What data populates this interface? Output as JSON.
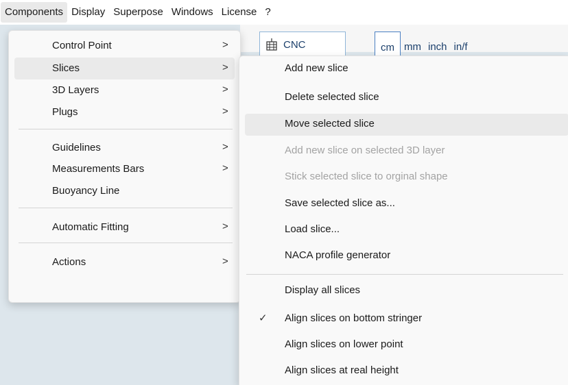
{
  "menubar": {
    "items": [
      "Components",
      "Display",
      "Superpose",
      "Windows",
      "License",
      "?"
    ]
  },
  "toolbar": {
    "cnc_label": "CNC",
    "units": [
      "cm",
      "mm",
      "inch",
      "in/f"
    ]
  },
  "components_menu": {
    "items": [
      {
        "label": "Control Point",
        "submenu": true
      },
      {
        "label": "Slices",
        "submenu": true
      },
      {
        "label": "3D Layers",
        "submenu": true
      },
      {
        "label": "Plugs",
        "submenu": true
      },
      {
        "label": "Guidelines",
        "submenu": true
      },
      {
        "label": "Measurements Bars",
        "submenu": true
      },
      {
        "label": "Buoyancy Line",
        "submenu": false
      },
      {
        "label": "Automatic Fitting",
        "submenu": true
      },
      {
        "label": "Actions",
        "submenu": true
      }
    ],
    "arrow": ">"
  },
  "slices_menu": {
    "items": [
      {
        "label": "Add new slice",
        "enabled": true
      },
      {
        "label": "Delete selected slice",
        "enabled": true
      },
      {
        "label": "Move selected slice",
        "enabled": true
      },
      {
        "label": "Add new slice on selected 3D layer",
        "enabled": false
      },
      {
        "label": "Stick selected slice to orginal shape",
        "enabled": false
      },
      {
        "label": "Save selected slice as...",
        "enabled": true
      },
      {
        "label": "Load slice...",
        "enabled": true
      },
      {
        "label": "NACA profile generator",
        "enabled": true
      },
      {
        "label": "Display all slices",
        "enabled": true
      },
      {
        "label": "Align slices on bottom stringer",
        "enabled": true,
        "checked": true
      },
      {
        "label": "Align slices on lower point",
        "enabled": true
      },
      {
        "label": "Align slices at real height",
        "enabled": true
      }
    ],
    "check": "✓"
  }
}
